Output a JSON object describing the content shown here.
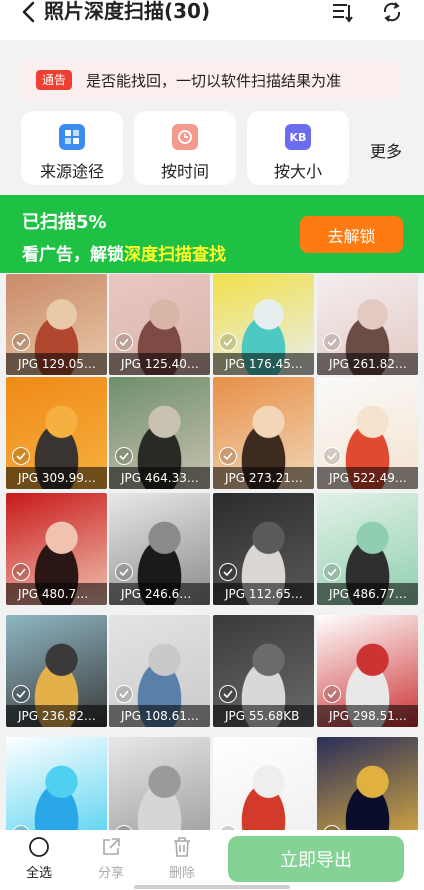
{
  "header": {
    "title": "照片深度扫描(30)"
  },
  "notice": {
    "tag": "通告",
    "text": "是否能找回，一切以软件扫描结果为准"
  },
  "filters": [
    {
      "label": "来源途径",
      "icon": "grid-icon",
      "color": "#3a8dee"
    },
    {
      "label": "按时间",
      "icon": "clock-icon",
      "color": "#f39a8e"
    },
    {
      "label": "按大小",
      "icon": "kb-icon",
      "color": "#6c6cf0"
    }
  ],
  "more_label": "更多",
  "banner": {
    "scan_status": "已扫描5%",
    "unlock_prefix": "看广告，解锁",
    "unlock_highlight": "深度扫描查找",
    "unlock_button": "去解锁"
  },
  "photos": [
    {
      "caption": "JPG  129.05…",
      "colors": [
        "#c98a6a",
        "#b0472e",
        "#e8c9a8"
      ]
    },
    {
      "caption": "JPG  125.40…",
      "colors": [
        "#e9c7c4",
        "#7d4a44",
        "#d9b5a8"
      ]
    },
    {
      "caption": "JPG  176.45…",
      "colors": [
        "#f2e04a",
        "#4ec9c2",
        "#e7eef0"
      ]
    },
    {
      "caption": "JPG  261.82…",
      "colors": [
        "#f4eef0",
        "#6b4d45",
        "#e3c9c2"
      ]
    },
    {
      "caption": "JPG  309.99…",
      "colors": [
        "#f08a18",
        "#3a3430",
        "#f5b040"
      ]
    },
    {
      "caption": "JPG  464.33…",
      "colors": [
        "#6f8f6c",
        "#2a2a25",
        "#c9c2b0"
      ]
    },
    {
      "caption": "JPG  273.21…",
      "colors": [
        "#e79048",
        "#3e2b20",
        "#f1d7b8"
      ]
    },
    {
      "caption": "JPG  522.49…",
      "colors": [
        "#fafafa",
        "#e04a2f",
        "#f5e3cf"
      ]
    },
    {
      "caption": "JPG  480.7…",
      "colors": [
        "#c8191a",
        "#2a1715",
        "#f0c2b0"
      ]
    },
    {
      "caption": "JPG  246.6…",
      "colors": [
        "#e8e8e8",
        "#1a1a1a",
        "#8a8a8a"
      ]
    },
    {
      "caption": "JPG  112.65…",
      "colors": [
        "#2c2c2c",
        "#d9d6d3",
        "#5a5a5a"
      ]
    },
    {
      "caption": "JPG  486.77…",
      "colors": [
        "#e2f1e6",
        "#2f2f2f",
        "#8fcfb0"
      ]
    },
    {
      "caption": "JPG  236.82…",
      "colors": [
        "#8fb7c4",
        "#e4b04a",
        "#3a3a3a"
      ]
    },
    {
      "caption": "JPG  108.61…",
      "colors": [
        "#e4e4e4",
        "#5a7fa8",
        "#c9c9c9"
      ]
    },
    {
      "caption": "JPG  55.68KB",
      "colors": [
        "#3a3a3a",
        "#d8d8d8",
        "#6b6b6b"
      ]
    },
    {
      "caption": "JPG  298.51…",
      "colors": [
        "#ffffff",
        "#e8e8e8",
        "#c33"
      ]
    },
    {
      "caption": "",
      "colors": [
        "#ffffff",
        "#2aa7e8",
        "#4fd0f0"
      ]
    },
    {
      "caption": "",
      "colors": [
        "#e8e8e8",
        "#d6d6d6",
        "#9a9a9a"
      ]
    },
    {
      "caption": "",
      "colors": [
        "#ffffff",
        "#d33a2a",
        "#eeeeee"
      ]
    },
    {
      "caption": "",
      "colors": [
        "#2a2f5a",
        "#0b0e2a",
        "#e0b040"
      ]
    }
  ],
  "bottombar": {
    "select_all": "全选",
    "share": "分享",
    "delete": "删除",
    "export": "立即导出"
  }
}
